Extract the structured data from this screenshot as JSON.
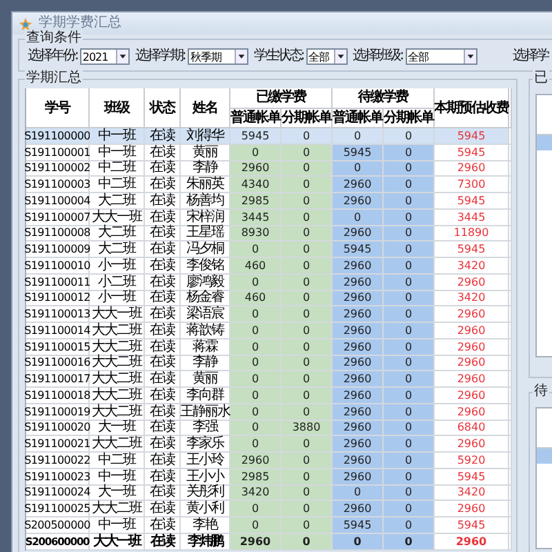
{
  "window": {
    "title": "学期学费汇总"
  },
  "query": {
    "title": "查询条件",
    "filters": [
      {
        "label": "选择年份:",
        "value": "2021",
        "kind": "short"
      },
      {
        "label": "选择学期:",
        "value": "秋季期",
        "kind": "medium"
      },
      {
        "label": "学生状态:",
        "value": "全部",
        "kind": "small"
      },
      {
        "label": "选择班级:",
        "value": "全部",
        "kind": "wide"
      }
    ],
    "trailing_label": "选择学"
  },
  "summary": {
    "title": "学期汇总",
    "columns": {
      "id": "学号",
      "class": "班级",
      "status": "状态",
      "name": "姓名",
      "paid_group": "已缴学费",
      "due_group": "待缴学费",
      "paid_regular": "普通帐单",
      "paid_installment": "分期帐单",
      "due_regular": "普通帐单",
      "due_installment": "分期帐单",
      "expected": "本期预估收费"
    },
    "rows": [
      {
        "id": "S191100000",
        "class": "中一班",
        "status": "在读",
        "name": "刘得华",
        "paid_regular": "5945",
        "paid_installment": "0",
        "due_regular": "0",
        "due_installment": "0",
        "expected": "5945",
        "selected": true,
        "bold": false
      },
      {
        "id": "S191100001",
        "class": "中一班",
        "status": "在读",
        "name": "黄丽",
        "paid_regular": "0",
        "paid_installment": "0",
        "due_regular": "5945",
        "due_installment": "0",
        "expected": "5945",
        "selected": false,
        "bold": false
      },
      {
        "id": "S191100002",
        "class": "中二班",
        "status": "在读",
        "name": "李静",
        "paid_regular": "2960",
        "paid_installment": "0",
        "due_regular": "0",
        "due_installment": "0",
        "expected": "2960",
        "selected": false,
        "bold": false
      },
      {
        "id": "S191100003",
        "class": "中二班",
        "status": "在读",
        "name": "朱丽英",
        "paid_regular": "4340",
        "paid_installment": "0",
        "due_regular": "2960",
        "due_installment": "0",
        "expected": "7300",
        "selected": false,
        "bold": false
      },
      {
        "id": "S191100004",
        "class": "大二班",
        "status": "在读",
        "name": "杨善均",
        "paid_regular": "2985",
        "paid_installment": "0",
        "due_regular": "2960",
        "due_installment": "0",
        "expected": "5945",
        "selected": false,
        "bold": false
      },
      {
        "id": "S191100007",
        "class": "大大一班",
        "status": "在读",
        "name": "宋梓润",
        "paid_regular": "3445",
        "paid_installment": "0",
        "due_regular": "0",
        "due_installment": "0",
        "expected": "3445",
        "selected": false,
        "bold": false
      },
      {
        "id": "S191100008",
        "class": "大二班",
        "status": "在读",
        "name": "王星瑶",
        "paid_regular": "8930",
        "paid_installment": "0",
        "due_regular": "2960",
        "due_installment": "0",
        "expected": "11890",
        "selected": false,
        "bold": false
      },
      {
        "id": "S191100009",
        "class": "大二班",
        "status": "在读",
        "name": "冯夕桐",
        "paid_regular": "0",
        "paid_installment": "0",
        "due_regular": "5945",
        "due_installment": "0",
        "expected": "5945",
        "selected": false,
        "bold": false
      },
      {
        "id": "S191100010",
        "class": "小一班",
        "status": "在读",
        "name": "李俊铭",
        "paid_regular": "460",
        "paid_installment": "0",
        "due_regular": "2960",
        "due_installment": "0",
        "expected": "3420",
        "selected": false,
        "bold": false
      },
      {
        "id": "S191100011",
        "class": "小二班",
        "status": "在读",
        "name": "廖鸿毅",
        "paid_regular": "0",
        "paid_installment": "0",
        "due_regular": "2960",
        "due_installment": "0",
        "expected": "2960",
        "selected": false,
        "bold": false
      },
      {
        "id": "S191100012",
        "class": "小一班",
        "status": "在读",
        "name": "杨金睿",
        "paid_regular": "460",
        "paid_installment": "0",
        "due_regular": "2960",
        "due_installment": "0",
        "expected": "3420",
        "selected": false,
        "bold": false
      },
      {
        "id": "S191100013",
        "class": "大大一班",
        "status": "在读",
        "name": "梁语宸",
        "paid_regular": "0",
        "paid_installment": "0",
        "due_regular": "2960",
        "due_installment": "0",
        "expected": "2960",
        "selected": false,
        "bold": false
      },
      {
        "id": "S191100014",
        "class": "大大二班",
        "status": "在读",
        "name": "蒋歆铸",
        "paid_regular": "0",
        "paid_installment": "0",
        "due_regular": "2960",
        "due_installment": "0",
        "expected": "2960",
        "selected": false,
        "bold": false
      },
      {
        "id": "S191100015",
        "class": "大大二班",
        "status": "在读",
        "name": "蒋霖",
        "paid_regular": "0",
        "paid_installment": "0",
        "due_regular": "2960",
        "due_installment": "0",
        "expected": "2960",
        "selected": false,
        "bold": false
      },
      {
        "id": "S191100016",
        "class": "大大二班",
        "status": "在读",
        "name": "李静",
        "paid_regular": "0",
        "paid_installment": "0",
        "due_regular": "2960",
        "due_installment": "0",
        "expected": "2960",
        "selected": false,
        "bold": false
      },
      {
        "id": "S191100017",
        "class": "大大二班",
        "status": "在读",
        "name": "黄丽",
        "paid_regular": "0",
        "paid_installment": "0",
        "due_regular": "2960",
        "due_installment": "0",
        "expected": "2960",
        "selected": false,
        "bold": false
      },
      {
        "id": "S191100018",
        "class": "大大二班",
        "status": "在读",
        "name": "李向群",
        "paid_regular": "0",
        "paid_installment": "0",
        "due_regular": "2960",
        "due_installment": "0",
        "expected": "2960",
        "selected": false,
        "bold": false
      },
      {
        "id": "S191100019",
        "class": "大大二班",
        "status": "在读",
        "name": "王静丽水",
        "paid_regular": "0",
        "paid_installment": "0",
        "due_regular": "2960",
        "due_installment": "0",
        "expected": "2960",
        "selected": false,
        "bold": false
      },
      {
        "id": "S191100020",
        "class": "大一班",
        "status": "在读",
        "name": "李强",
        "paid_regular": "0",
        "paid_installment": "3880",
        "due_regular": "2960",
        "due_installment": "0",
        "expected": "6840",
        "selected": false,
        "bold": false
      },
      {
        "id": "S191100021",
        "class": "大大二班",
        "status": "在读",
        "name": "李家乐",
        "paid_regular": "0",
        "paid_installment": "0",
        "due_regular": "2960",
        "due_installment": "0",
        "expected": "2960",
        "selected": false,
        "bold": false
      },
      {
        "id": "S191100022",
        "class": "中二班",
        "status": "在读",
        "name": "王小玲",
        "paid_regular": "2960",
        "paid_installment": "0",
        "due_regular": "2960",
        "due_installment": "0",
        "expected": "5920",
        "selected": false,
        "bold": false
      },
      {
        "id": "S191100023",
        "class": "中一班",
        "status": "在读",
        "name": "王小小",
        "paid_regular": "2985",
        "paid_installment": "0",
        "due_regular": "2960",
        "due_installment": "0",
        "expected": "5945",
        "selected": false,
        "bold": false
      },
      {
        "id": "S191100024",
        "class": "大一班",
        "status": "在读",
        "name": "关彤利",
        "paid_regular": "3420",
        "paid_installment": "0",
        "due_regular": "0",
        "due_installment": "0",
        "expected": "3420",
        "selected": false,
        "bold": false
      },
      {
        "id": "S191100025",
        "class": "大大二班",
        "status": "在读",
        "name": "黄小利",
        "paid_regular": "0",
        "paid_installment": "0",
        "due_regular": "2960",
        "due_installment": "0",
        "expected": "2960",
        "selected": false,
        "bold": false
      },
      {
        "id": "S200500000",
        "class": "中一班",
        "status": "在读",
        "name": "李艳",
        "paid_regular": "0",
        "paid_installment": "0",
        "due_regular": "5945",
        "due_installment": "0",
        "expected": "5945",
        "selected": false,
        "bold": false
      },
      {
        "id": "S200600000",
        "class": "大大一班",
        "status": "在读",
        "name": "李炜鹏",
        "paid_regular": "2960",
        "paid_installment": "0",
        "due_regular": "0",
        "due_installment": "0",
        "expected": "2960",
        "selected": false,
        "bold": true
      }
    ]
  },
  "side_panels": [
    {
      "title": "已"
    },
    {
      "title": "待"
    }
  ]
}
